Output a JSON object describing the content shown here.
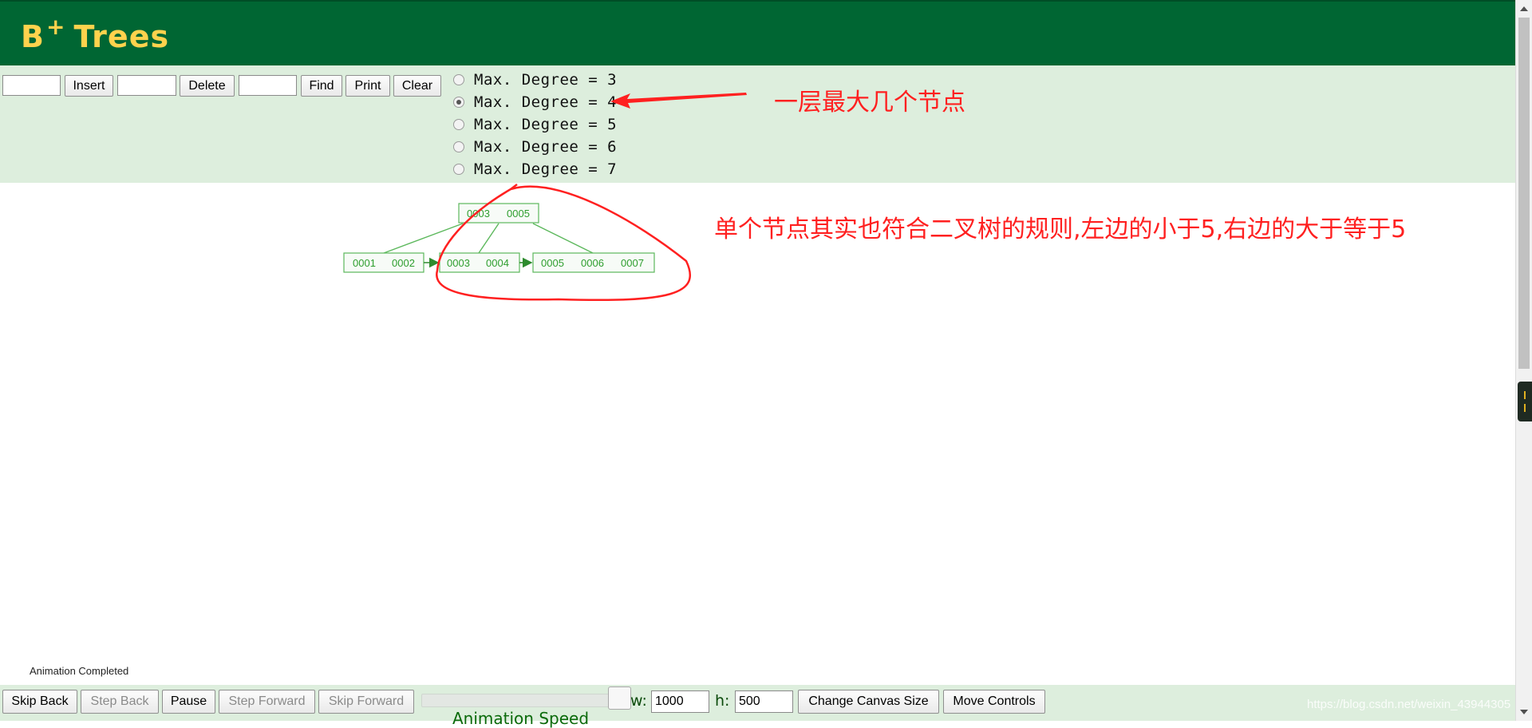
{
  "header": {
    "title_main": "B",
    "title_sup": "+",
    "title_rest": "Trees"
  },
  "controls": {
    "insert_value": "",
    "insert_label": "Insert",
    "delete_value": "",
    "delete_label": "Delete",
    "find_value": "",
    "find_label": "Find",
    "print_label": "Print",
    "clear_label": "Clear",
    "degree_options": [
      {
        "label": "Max. Degree = 3",
        "checked": false
      },
      {
        "label": "Max. Degree = 4",
        "checked": true
      },
      {
        "label": "Max. Degree = 5",
        "checked": false
      },
      {
        "label": "Max. Degree = 6",
        "checked": false
      },
      {
        "label": "Max. Degree = 7",
        "checked": false
      }
    ]
  },
  "annotations": {
    "degree_note": "一层最大几个节点",
    "node_note": "单个节点其实也符合二叉树的规则,左边的小于5,右边的大于等于5",
    "color": "#ff2020"
  },
  "tree": {
    "root_keys": [
      "0003",
      "0005"
    ],
    "leaves": [
      {
        "keys": [
          "0001",
          "0002"
        ]
      },
      {
        "keys": [
          "0003",
          "0004"
        ]
      },
      {
        "keys": [
          "0005",
          "0006",
          "0007"
        ]
      }
    ],
    "color": "#5cb85c"
  },
  "status": {
    "text": "Animation Completed"
  },
  "bottom_bar": {
    "skip_back": "Skip Back",
    "step_back": "Step Back",
    "pause": "Pause",
    "step_forward": "Step Forward",
    "skip_forward": "Skip Forward",
    "width_label": "w:",
    "width_value": "1000",
    "height_label": "h:",
    "height_value": "500",
    "change_canvas": "Change Canvas Size",
    "move_controls": "Move Controls",
    "speed_label": "Animation Speed",
    "watermark": "https://blog.csdn.net/weixin_43944305"
  },
  "colors": {
    "header_bg": "#006633",
    "title": "#ffd24d",
    "panel_bg": "#ddeedd"
  }
}
